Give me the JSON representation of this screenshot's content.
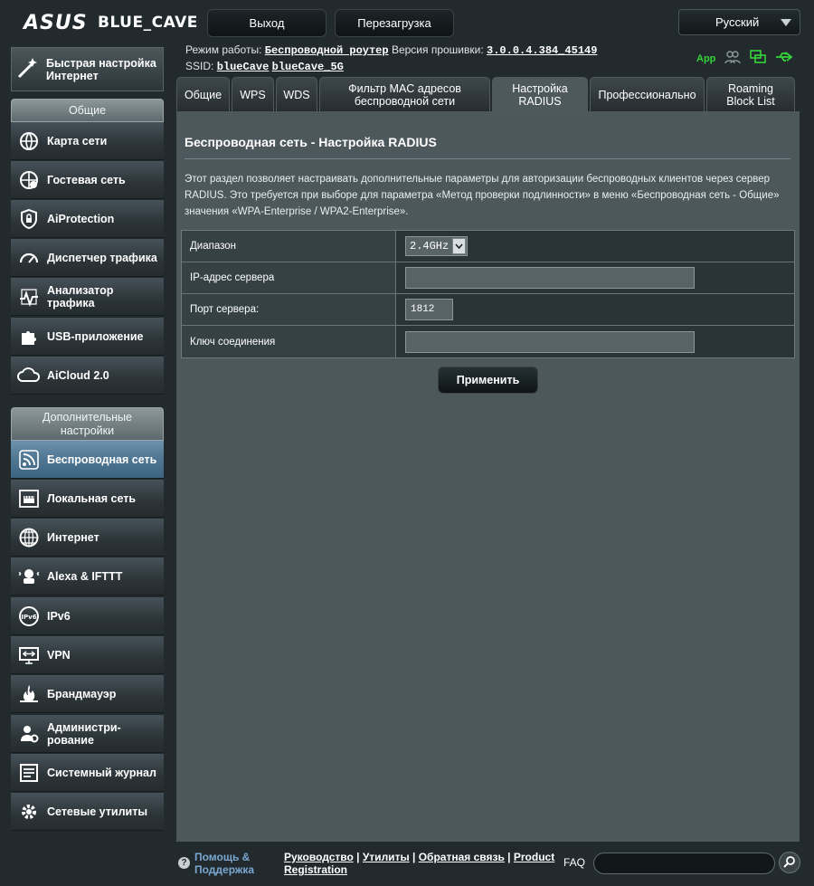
{
  "header": {
    "brand": "ASUS",
    "model": "BLUE_CAVE",
    "logout_label": "Выход",
    "reboot_label": "Перезагрузка",
    "language": "Русский"
  },
  "info": {
    "mode_label": "Режим работы:",
    "mode_value": "Беспроводной роутер",
    "firmware_label": "Версия прошивки:",
    "firmware_value": "3.0.0.4.384_45149",
    "ssid_label": "SSID:",
    "ssid_1": "blueCave",
    "ssid_2": "blueCave_5G",
    "app_label": "App"
  },
  "sidebar": {
    "quick_setup": "Быстрая настройка Интернет",
    "general_header": "Общие",
    "general_items": [
      {
        "label": "Карта сети",
        "icon": "globe-network-icon"
      },
      {
        "label": "Гостевая сеть",
        "icon": "guest-network-icon"
      },
      {
        "label": "AiProtection",
        "icon": "lock-icon"
      },
      {
        "label": "Диспетчер трафика",
        "icon": "gauge-icon"
      },
      {
        "label": "Анализатор трафика",
        "icon": "analyzer-icon"
      },
      {
        "label": "USB-приложение",
        "icon": "puzzle-icon"
      },
      {
        "label": "AiCloud 2.0",
        "icon": "cloud-icon"
      }
    ],
    "advanced_header": "Дополнительные настройки",
    "advanced_items": [
      {
        "label": "Беспроводная сеть",
        "icon": "wifi-icon"
      },
      {
        "label": "Локальная сеть",
        "icon": "lan-icon"
      },
      {
        "label": "Интернет",
        "icon": "globe-icon"
      },
      {
        "label": "Alexa & IFTTT",
        "icon": "alexa-icon"
      },
      {
        "label": "IPv6",
        "icon": "ipv6-icon"
      },
      {
        "label": "VPN",
        "icon": "vpn-icon"
      },
      {
        "label": "Брандмауэр",
        "icon": "firewall-icon"
      },
      {
        "label": "Администри- рование",
        "icon": "admin-icon"
      },
      {
        "label": "Системный журнал",
        "icon": "log-icon"
      },
      {
        "label": "Сетевые утилиты",
        "icon": "gear-icon"
      }
    ]
  },
  "tabs": [
    {
      "label": "Общие"
    },
    {
      "label": "WPS"
    },
    {
      "label": "WDS"
    },
    {
      "label": "Фильтр MAC адресов беспроводной сети"
    },
    {
      "label": "Настройка RADIUS"
    },
    {
      "label": "Профессионально"
    },
    {
      "label": "Roaming Block List"
    }
  ],
  "main": {
    "title": "Беспроводная сеть - Настройка RADIUS",
    "description": "Этот раздел позволяет настраивать дополнительные параметры для авторизации беспроводных клиентов через сервер RADIUS. Это требуется при выборе для параметра «Метод проверки подлинности» в меню «Беспроводная сеть - Общие» значения «WPA-Enterprise / WPA2-Enterprise».",
    "band_label": "Диапазон",
    "band_value": "2.4GHz",
    "server_ip_label": "IP-адрес сервера",
    "server_ip_value": "",
    "server_port_label": "Порт сервера:",
    "server_port_value": "1812",
    "key_label": "Ключ соединения",
    "key_value": "",
    "apply_label": "Применить"
  },
  "footer": {
    "help_label": "Помощь & Поддержка",
    "links": [
      "Руководство",
      "Утилиты",
      "Обратная связь",
      "Product Registration"
    ],
    "faq_label": "FAQ",
    "search_value": ""
  },
  "colors": {
    "active_nav": "#4e7591",
    "panel": "#4d585c",
    "status_green": "#35d33a",
    "help_link": "#7aa7d1"
  }
}
